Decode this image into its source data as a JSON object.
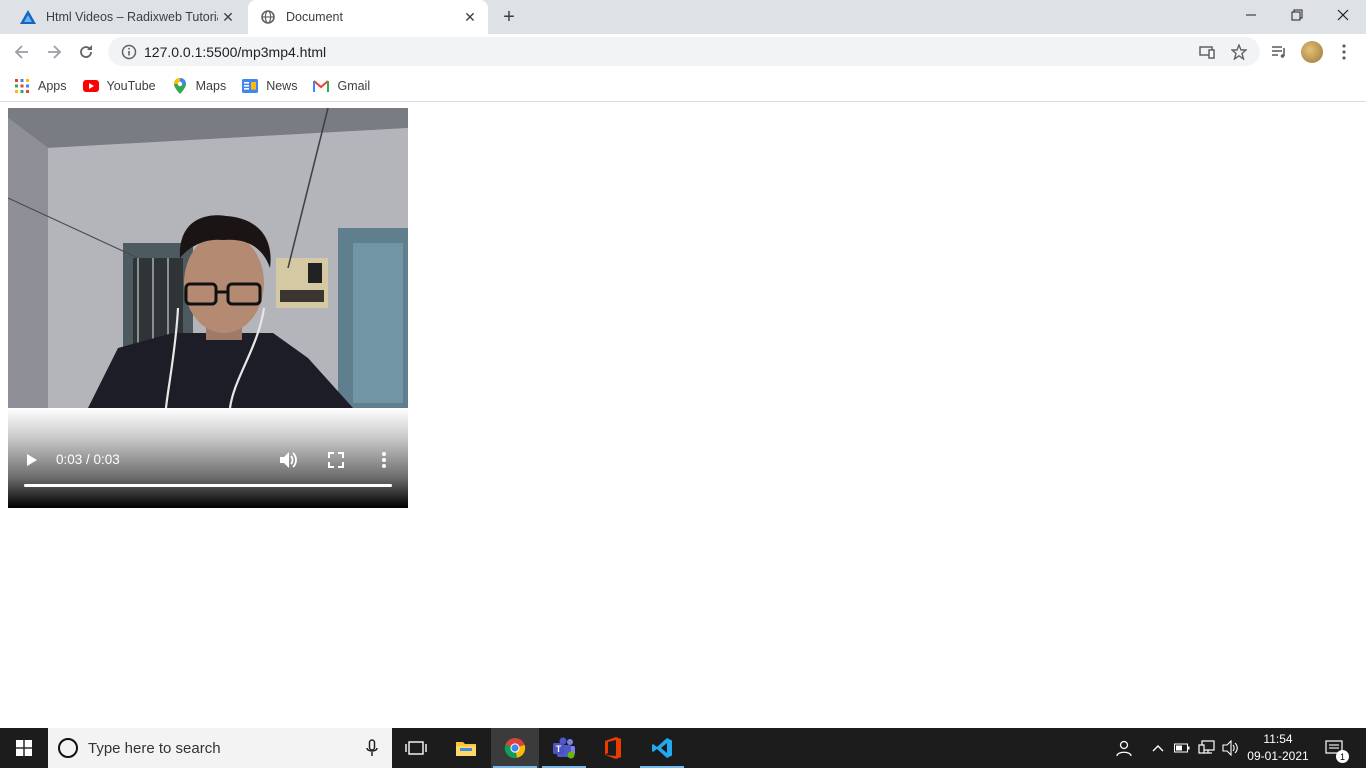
{
  "browser": {
    "tabs": [
      {
        "title": "Html Videos – Radixweb Tutorial",
        "active": false,
        "favicon": "radixweb-logo-icon"
      },
      {
        "title": "Document",
        "active": true,
        "favicon": "globe-icon"
      }
    ],
    "url": "127.0.0.1:5500/mp3mp4.html",
    "bookmarks": [
      {
        "label": "Apps",
        "icon": "apps-grid-icon"
      },
      {
        "label": "YouTube",
        "icon": "youtube-icon"
      },
      {
        "label": "Maps",
        "icon": "maps-pin-icon"
      },
      {
        "label": "News",
        "icon": "google-news-icon"
      },
      {
        "label": "Gmail",
        "icon": "gmail-icon"
      }
    ]
  },
  "video": {
    "time": "0:03 / 0:03",
    "progress": 1.0,
    "state": "paused"
  },
  "taskbar": {
    "search_placeholder": "Type here to search",
    "time": "11:54",
    "date": "09-01-2021",
    "notification_count": "1",
    "apps": [
      "windows-start-icon",
      "task-view-icon",
      "file-explorer-icon",
      "chrome-icon",
      "teams-icon",
      "office-icon",
      "vscode-icon"
    ]
  },
  "colors": {
    "tabstrip_bg": "#dee1e6",
    "omnibox_bg": "#f1f3f4",
    "taskbar_bg": "#1c1c1c",
    "accent": "#76b9ed"
  }
}
